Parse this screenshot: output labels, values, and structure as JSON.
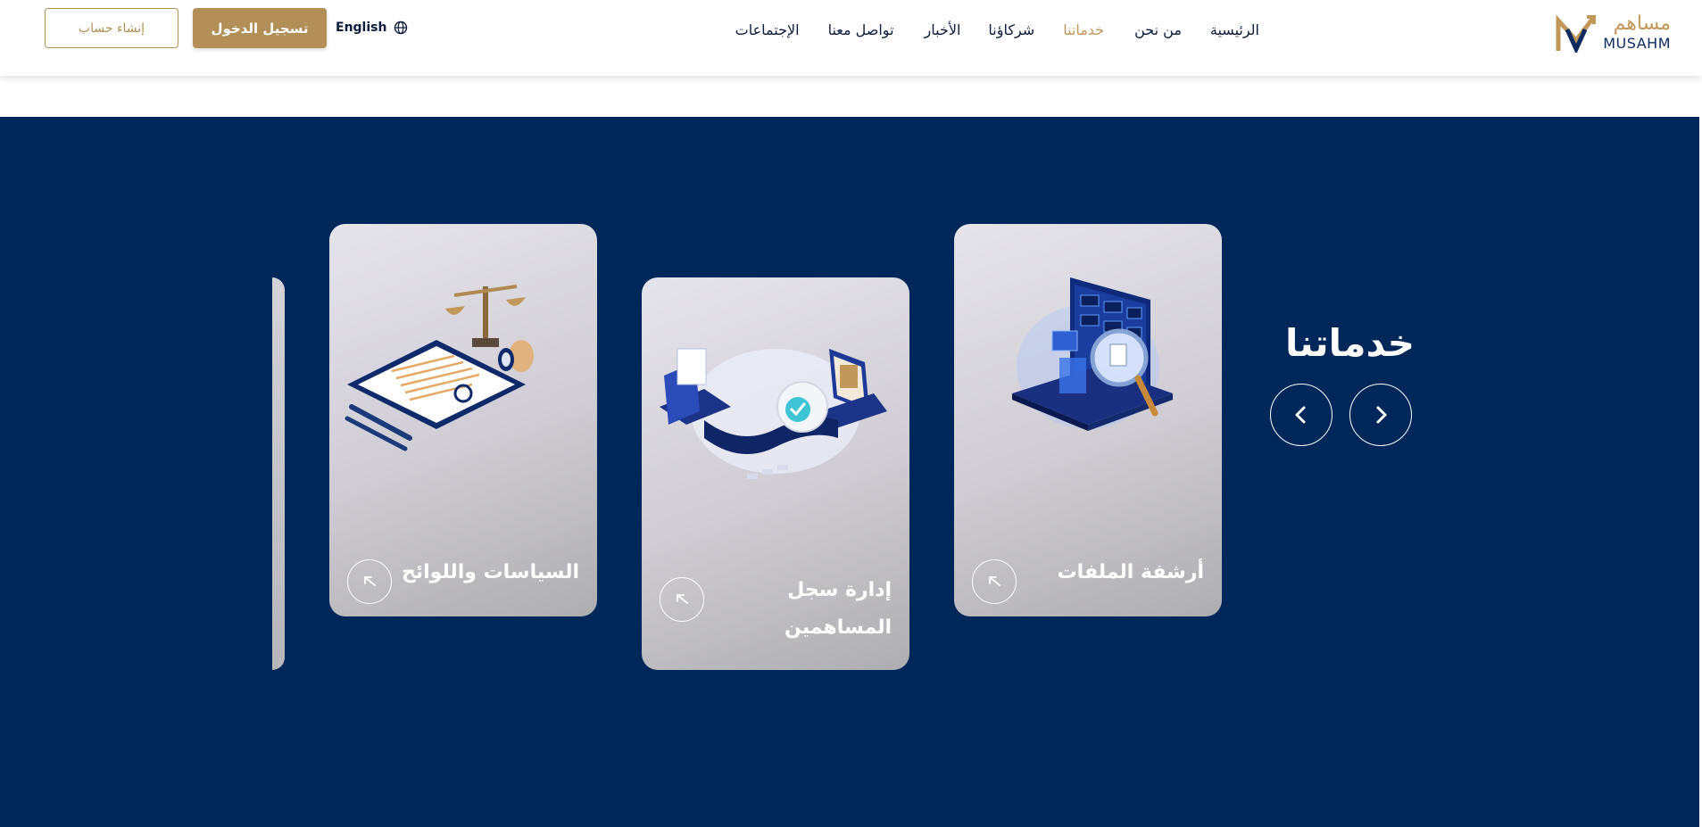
{
  "header": {
    "logo": {
      "arabic": "مساهم",
      "english": "MUSAHM",
      "icon": "musahm-logo-mark"
    },
    "nav": [
      {
        "label": "الرئيسية",
        "active": false
      },
      {
        "label": "من نحن",
        "active": false
      },
      {
        "label": "خدماتنا",
        "active": true
      },
      {
        "label": "شركاؤنا",
        "active": false
      },
      {
        "label": "الأخبار",
        "active": false
      },
      {
        "label": "تواصل معنا",
        "active": false
      },
      {
        "label": "الإجتماعات",
        "active": false
      }
    ],
    "language": {
      "label": "English",
      "icon": "globe-icon"
    },
    "login_button": "تسجيل الدخول",
    "signup_button": "إنشاء حساب"
  },
  "services": {
    "title": "خدماتنا",
    "prev_icon": "chevron-left-icon",
    "next_icon": "chevron-right-icon",
    "cards": [
      {
        "title": "أرشفة الملفات",
        "illustration": "laptop-magnifier-archive",
        "icon": "arrow-up-left-icon"
      },
      {
        "title": "إدارة سجل\nالمساهمين",
        "illustration": "laptops-cloud-transfer",
        "icon": "arrow-up-left-icon"
      },
      {
        "title": "السياسات واللوائح",
        "illustration": "scales-document-stamp",
        "icon": "arrow-up-left-icon"
      }
    ]
  },
  "colors": {
    "brand_gold": "#b28f56",
    "section_navy": "#00275a",
    "nav_text": "#0b1c3d"
  }
}
